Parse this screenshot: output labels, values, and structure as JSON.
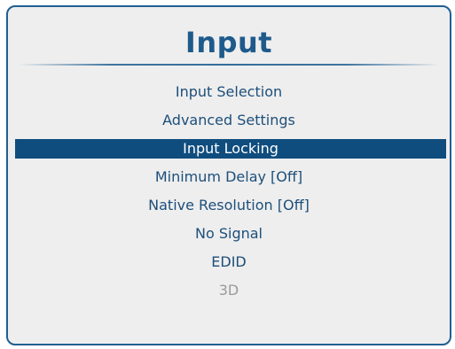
{
  "menu": {
    "title": "Input",
    "items": [
      {
        "label": "Input Selection",
        "state": "normal"
      },
      {
        "label": "Advanced Settings",
        "state": "normal"
      },
      {
        "label": "Input Locking",
        "state": "selected"
      },
      {
        "label": "Minimum Delay [Off]",
        "state": "normal"
      },
      {
        "label": "Native Resolution [Off]",
        "state": "normal"
      },
      {
        "label": "No Signal",
        "state": "normal"
      },
      {
        "label": "EDID",
        "state": "normal"
      },
      {
        "label": "3D",
        "state": "disabled"
      }
    ]
  },
  "colors": {
    "accent": "#1f5f92",
    "selected_background": "#0f4d7e",
    "panel_background": "#eeeeee",
    "item_text": "#1d4f7a",
    "disabled_text": "#9a9a9a"
  }
}
